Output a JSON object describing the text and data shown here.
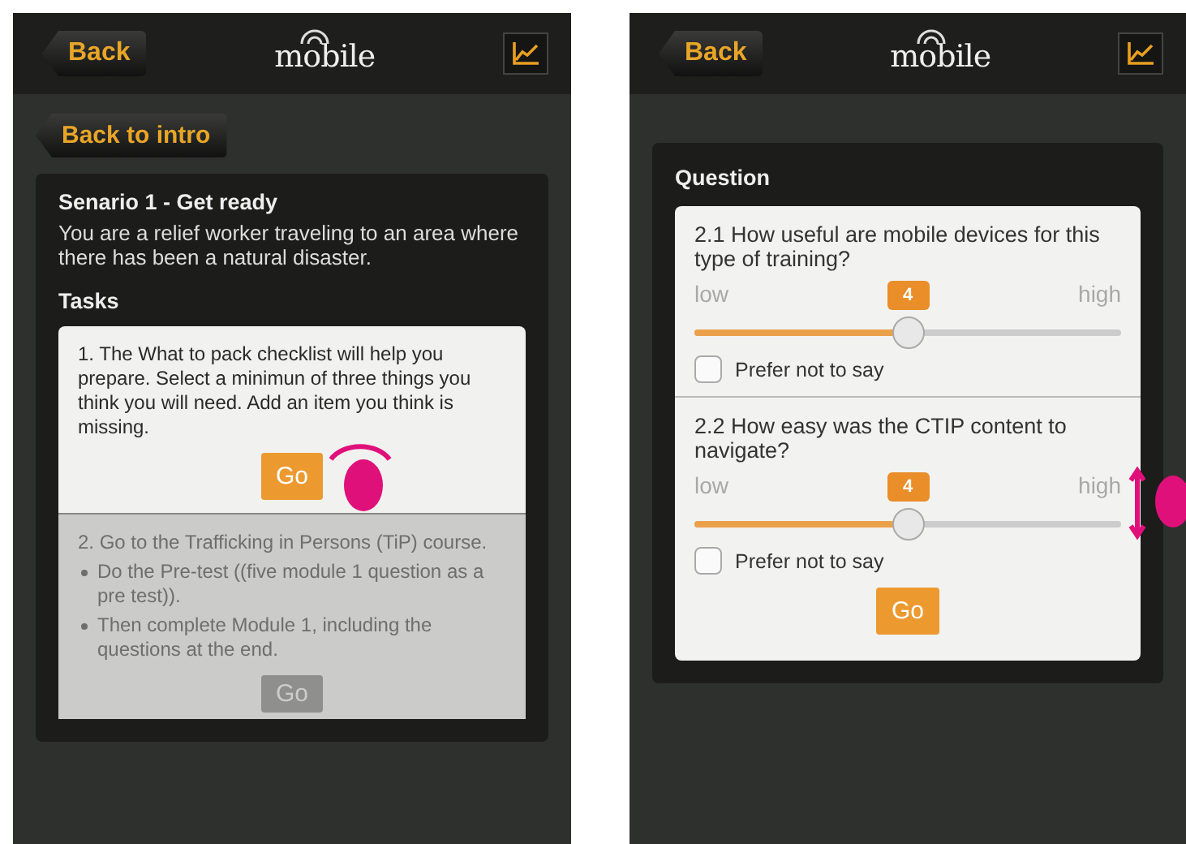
{
  "left_screen": {
    "header": {
      "back": "Back",
      "logo": "mobile"
    },
    "back_to_intro": "Back to intro",
    "card": {
      "title": "Senario 1 - Get ready",
      "description": "You are a relief worker traveling to an area where there has been a natural disaster.",
      "tasks_heading": "Tasks",
      "tasks": [
        {
          "text": "1. The What to pack checklist will help you prepare. Select a minimun of three things you think you will need. Add an item you think is missing.",
          "button": "Go",
          "disabled": false
        },
        {
          "text": "2. Go to the Trafficking in Persons (TiP) course.",
          "bullets": [
            "Do the Pre-test ((five module 1 question as a pre test)).",
            "Then complete Module 1, including the questions at the end."
          ],
          "button": "Go",
          "disabled": true
        }
      ]
    }
  },
  "right_screen": {
    "header": {
      "back": "Back",
      "logo": "mobile"
    },
    "card": {
      "title": "Question",
      "questions": [
        {
          "text": "2.1 How useful are mobile devices for this type of training?",
          "low": "low",
          "high": "high",
          "value": "4",
          "level": 0.5,
          "prefer_not": {
            "label": "Prefer not to say",
            "checked": false
          }
        },
        {
          "text": "2.2 How easy was the CTIP content to navigate?",
          "low": "low",
          "high": "high",
          "value": "4",
          "level": 0.5,
          "prefer_not": {
            "label": "Prefer not to say",
            "checked": false
          }
        }
      ],
      "button": "Go"
    }
  }
}
